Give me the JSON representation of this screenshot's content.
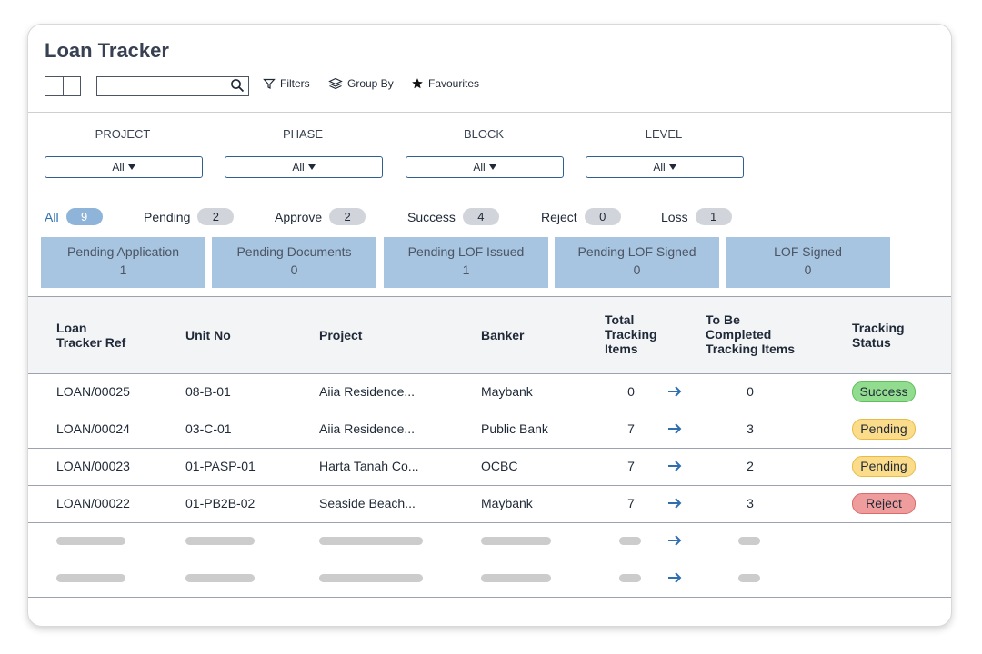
{
  "app": {
    "title": "Loan Tracker"
  },
  "toolbar": {
    "search_placeholder": "",
    "filters_label": "Filters",
    "group_by_label": "Group By",
    "favourites_label": "Favourites"
  },
  "filters": [
    {
      "label": "PROJECT",
      "value": "All"
    },
    {
      "label": "PHASE",
      "value": "All"
    },
    {
      "label": "BLOCK",
      "value": "All"
    },
    {
      "label": "LEVEL",
      "value": "All"
    }
  ],
  "status_tabs": [
    {
      "label": "All",
      "count": "9",
      "active": true
    },
    {
      "label": "Pending",
      "count": "2"
    },
    {
      "label": "Approve",
      "count": "2"
    },
    {
      "label": "Success",
      "count": "4"
    },
    {
      "label": "Reject",
      "count": "0"
    },
    {
      "label": "Loss",
      "count": "1"
    }
  ],
  "stages": [
    {
      "label": "Pending Application",
      "count": "1"
    },
    {
      "label": "Pending Documents",
      "count": "0"
    },
    {
      "label": "Pending LOF Issued",
      "count": "1"
    },
    {
      "label": "Pending LOF Signed",
      "count": "0"
    },
    {
      "label": "LOF Signed",
      "count": "0"
    }
  ],
  "table": {
    "headers": {
      "ref_line1": "Loan",
      "ref_line2": "Tracker Ref",
      "unit": "Unit No",
      "project": "Project",
      "banker": "Banker",
      "total_line1": "Total",
      "total_line2": "Tracking",
      "total_line3": "Items",
      "tbc_line1": "To Be",
      "tbc_line2": "Completed",
      "tbc_line3": "Tracking Items",
      "status_line1": "Tracking",
      "status_line2": "Status"
    },
    "rows": [
      {
        "ref": "LOAN/00025",
        "unit": "08-B-01",
        "project": "Aiia Residence...",
        "banker": "Maybank",
        "total": "0",
        "tbc": "0",
        "status": "Success"
      },
      {
        "ref": "LOAN/00024",
        "unit": "03-C-01",
        "project": "Aiia Residence...",
        "banker": "Public Bank",
        "total": "7",
        "tbc": "3",
        "status": "Pending"
      },
      {
        "ref": "LOAN/00023",
        "unit": "01-PASP-01",
        "project": "Harta Tanah Co...",
        "banker": "OCBC",
        "total": "7",
        "tbc": "2",
        "status": "Pending"
      },
      {
        "ref": "LOAN/00022",
        "unit": "01-PB2B-02",
        "project": "Seaside Beach...",
        "banker": "Maybank",
        "total": "7",
        "tbc": "3",
        "status": "Reject"
      }
    ]
  },
  "status_colors": {
    "Success": {
      "bg": "#92dc8f",
      "border": "#5fbf5b"
    },
    "Pending": {
      "bg": "#fbdc8a",
      "border": "#e7bb45"
    },
    "Reject": {
      "bg": "#ee9c9c",
      "border": "#d96b6b"
    }
  },
  "colors": {
    "accent": "#2f6fb0",
    "stage_bg": "#a7c4e0"
  }
}
